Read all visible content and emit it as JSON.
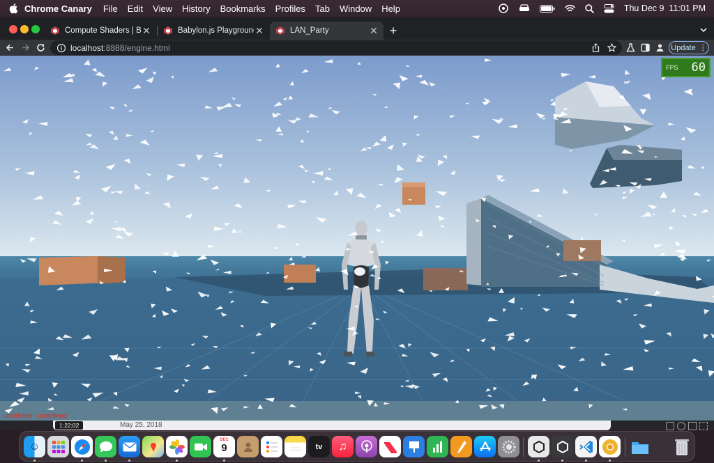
{
  "menubar": {
    "app_name": "Chrome Canary",
    "menus": [
      "File",
      "Edit",
      "View",
      "History",
      "Bookmarks",
      "Profiles",
      "Tab",
      "Window",
      "Help"
    ],
    "clock": "Thu Dec 9  11:01 PM"
  },
  "browser": {
    "tabs": [
      {
        "title": "Compute Shaders | Babylon.js",
        "active": false
      },
      {
        "title": "Babylon.js Playground",
        "active": false
      },
      {
        "title": "LAN_Party",
        "active": true
      }
    ],
    "url_host": "localhost",
    "url_path": ":8888/engine.html",
    "update_label": "Update"
  },
  "scene": {
    "fps_label": "FPS",
    "fps_value": "60",
    "status_text": "undefined - undefined",
    "colors": {
      "sky_top": "#7f9ece",
      "sky_horizon": "#d6e4ee",
      "water": "#3e6f92",
      "crate": "#c8875c",
      "fps_panel": "#2f7a1c"
    }
  },
  "behind_window": {
    "duration": "1:22:02",
    "date": "May 25, 2018"
  },
  "dock": {
    "calendar_month": "DEC",
    "calendar_day": "9",
    "items": [
      "finder-icon",
      "launchpad-icon",
      "safari-icon",
      "messages-icon",
      "mail-icon",
      "maps-icon",
      "photos-icon",
      "facetime-icon",
      "calendar-icon",
      "contacts-icon",
      "reminders-icon",
      "notes-icon",
      "apple-tv-icon",
      "music-icon",
      "podcasts-icon",
      "news-icon",
      "keynote-icon",
      "numbers-icon",
      "pages-icon",
      "app-store-icon",
      "system-preferences-icon",
      "unity-hub-icon",
      "unity-icon",
      "vscode-icon",
      "chrome-canary-icon",
      "folder-icon",
      "trash-icon"
    ]
  }
}
